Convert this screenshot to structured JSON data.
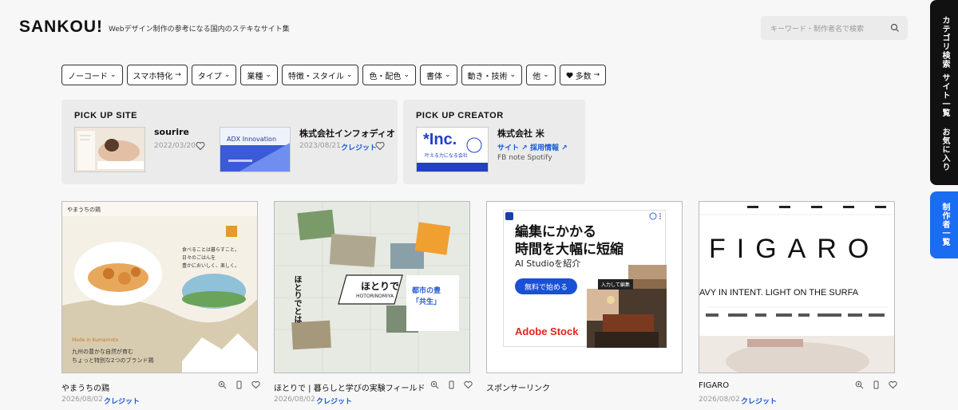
{
  "header": {
    "logo": "SANKOU!",
    "tagline": "Webデザイン制作の参考になる国内のステキなサイト集",
    "search_placeholder": "キーワード・制作者名で検索"
  },
  "filters": [
    {
      "label": "ノーコード",
      "suffix": "⌄"
    },
    {
      "label": "スマホ特化",
      "suffix": "→"
    },
    {
      "label": "タイプ",
      "suffix": "⌄"
    },
    {
      "label": "業種",
      "suffix": "⌄"
    },
    {
      "label": "特徴・スタイル",
      "suffix": "⌄"
    },
    {
      "label": "色・配色",
      "suffix": "⌄"
    },
    {
      "label": "書体",
      "suffix": "⌄"
    },
    {
      "label": "動き・技術",
      "suffix": "⌄"
    },
    {
      "label": "他",
      "suffix": "⌄"
    },
    {
      "label": "多数",
      "suffix": "→"
    }
  ],
  "pickup_site": {
    "title": "PICK UP SITE",
    "items": [
      {
        "name": "sourire",
        "date": "2022/03/20",
        "credit": ""
      },
      {
        "name": "株式会社インフォディオ",
        "date": "2023/08/21",
        "credit": "クレジット",
        "thumb_text": "ADX Innovation"
      }
    ]
  },
  "pickup_creator": {
    "title": "PICK UP CREATOR",
    "name": "株式会社 米",
    "link_site": "サイト ↗",
    "link_recruit": "採用情報 ↗",
    "social": "FB  note  Spotify",
    "thumb_big": "*Inc.",
    "thumb_small": "叶える力になる会社"
  },
  "cards": [
    {
      "title": "やまうちの鶏",
      "date": "2026/08/02",
      "credit": "クレジット",
      "shot": {
        "line1": "Made in Kumamoto",
        "line2": "九州の豊かな自然が育む",
        "line3": "ちょっと特別な2つのブランド鶏",
        "copy1": "食べることは暮らすこと。",
        "copy2": "日々のごはんを",
        "copy3": "豊かにおいしく、楽しく。"
      }
    },
    {
      "title": "ほとりで | 暮らしと学びの実験フィールド",
      "date": "2026/08/02",
      "credit": "クレジット",
      "shot": {
        "sign": "ほとりで",
        "sub": "HOTORINOMIYA",
        "side": "ほとりでとは",
        "tag1": "都市の豊",
        "tag2": "「共生」"
      }
    },
    {
      "title": "スポンサーリンク",
      "date": "",
      "credit": "",
      "ad": {
        "headline1": "編集にかかる",
        "headline2": "時間を大幅に短縮",
        "sub": "AI Studioを紹介",
        "cta": "無料で始める",
        "brand": "Adobe Stock",
        "tooltip": "入力して編集"
      }
    },
    {
      "title": "FIGARO",
      "date": "2026/08/02",
      "credit": "クレジット",
      "shot": {
        "logo": "FIGARO",
        "marquee": "AVY IN INTENT. LIGHT ON THE SURFA"
      }
    }
  ],
  "side_nav": {
    "items": [
      "カテゴリ検索",
      "サイト一覧",
      "お気に入り"
    ],
    "creators": "制作者一覧"
  },
  "colors": {
    "accent": "#1a6cf0",
    "link": "#1a56d6",
    "dark": "#111111"
  }
}
